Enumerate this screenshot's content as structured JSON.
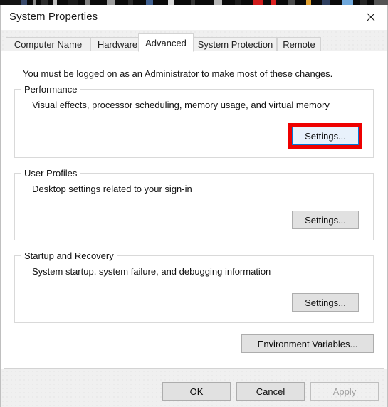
{
  "window": {
    "title": "System Properties",
    "close_icon": "close-icon"
  },
  "tabs": [
    {
      "label": "Computer Name",
      "selected": false
    },
    {
      "label": "Hardware",
      "selected": false
    },
    {
      "label": "Advanced",
      "selected": true
    },
    {
      "label": "System Protection",
      "selected": false
    },
    {
      "label": "Remote",
      "selected": false
    }
  ],
  "main": {
    "admin_note": "You must be logged on as an Administrator to make most of these changes.",
    "groups": [
      {
        "id": "performance",
        "label": "Performance",
        "description": "Visual effects, processor scheduling, memory usage, and virtual memory",
        "button_label": "Settings...",
        "highlighted": true
      },
      {
        "id": "user-profiles",
        "label": "User Profiles",
        "description": "Desktop settings related to your sign-in",
        "button_label": "Settings...",
        "highlighted": false
      },
      {
        "id": "startup-and-recovery",
        "label": "Startup and Recovery",
        "description": "System startup, system failure, and debugging information",
        "button_label": "Settings...",
        "highlighted": false
      }
    ],
    "environment_variables_label": "Environment Variables..."
  },
  "footer": {
    "ok_label": "OK",
    "cancel_label": "Cancel",
    "apply_label": "Apply",
    "apply_disabled": true
  },
  "colors": {
    "annotation_red": "#ee0000",
    "focus_blue": "#0078d7",
    "focus_fill": "#e8f1fb",
    "button_face": "#e1e1e1",
    "dialog_background": "#f0f0f0",
    "panel_white": "#ffffff"
  }
}
